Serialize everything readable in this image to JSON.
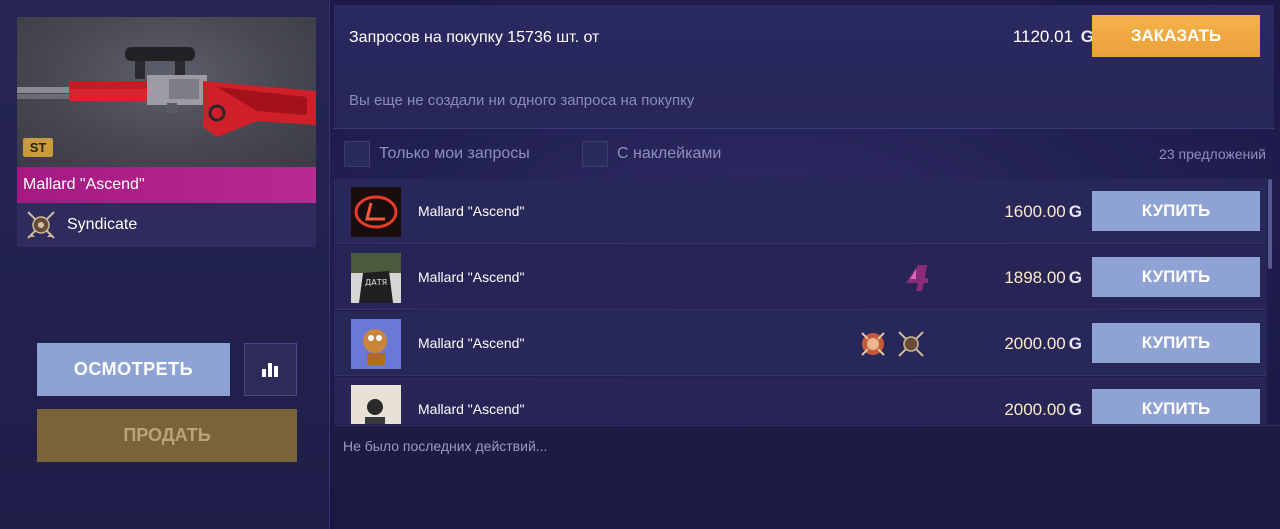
{
  "item": {
    "badge": "ST",
    "name": "Mallard \"Ascend\"",
    "collection": "Syndicate"
  },
  "actions": {
    "inspect_label": "ОСМОТРЕТЬ",
    "sell_label": "ПРОДАТЬ",
    "stats_icon": "bar-chart-icon"
  },
  "request": {
    "title": "Запросов на покупку 15736 шт. от",
    "price": "1120.01",
    "currency_symbol": "G",
    "order_label": "ЗАКАЗАТЬ",
    "empty_message": "Вы еще не создали ни одного запроса на покупку"
  },
  "filters": {
    "only_mine_label": "Только мои запросы",
    "with_stickers_label": "С наклейками",
    "offers_count": "23 предложений"
  },
  "offers": [
    {
      "name": "Mallard \"Ascend\"",
      "price": "1600.00",
      "buy_label": "КУПИТЬ",
      "stickers": []
    },
    {
      "name": "Mallard \"Ascend\"",
      "price": "1898.00",
      "buy_label": "КУПИТЬ",
      "stickers": [
        "number-4-sticker"
      ]
    },
    {
      "name": "Mallard \"Ascend\"",
      "price": "2000.00",
      "buy_label": "КУПИТЬ",
      "stickers": [
        "emblem-sticker",
        "syndicate-sticker"
      ]
    },
    {
      "name": "Mallard \"Ascend\"",
      "price": "2000.00",
      "buy_label": "КУПИТЬ",
      "stickers": []
    }
  ],
  "activity": {
    "message": "Не было последних действий..."
  },
  "colors": {
    "accent_orange": "#f0a940",
    "button_blue": "#8ea2d4",
    "rarity_pink": "#b72a92",
    "sell_brown": "#7a6338"
  }
}
